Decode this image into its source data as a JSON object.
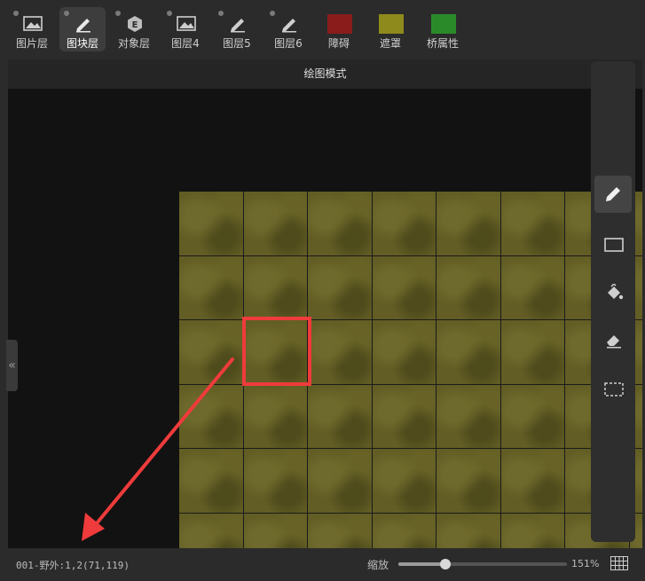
{
  "toolbar": {
    "items": [
      {
        "label": "图片层",
        "icon": "image-icon",
        "active": false
      },
      {
        "label": "图块层",
        "icon": "pencil-icon",
        "active": true
      },
      {
        "label": "对象层",
        "icon": "object-e-icon",
        "active": false
      },
      {
        "label": "图层4",
        "icon": "image-icon",
        "active": false
      },
      {
        "label": "图层5",
        "icon": "pencil-icon",
        "active": false
      },
      {
        "label": "图层6",
        "icon": "pencil-icon",
        "active": false
      }
    ],
    "swatches": [
      {
        "label": "障碍",
        "color": "#8b1c1c"
      },
      {
        "label": "遮罩",
        "color": "#8e8a1c"
      },
      {
        "label": "桥属性",
        "color": "#2a8a2a"
      }
    ]
  },
  "editor": {
    "mode_title": "绘图模式",
    "collapse_glyph": "«"
  },
  "right_tools": [
    {
      "name": "pencil-tool",
      "icon": "pencil-icon",
      "active": true
    },
    {
      "name": "rectangle-tool",
      "icon": "rectangle-icon",
      "active": false
    },
    {
      "name": "fill-tool",
      "icon": "paint-bucket-icon",
      "active": false
    },
    {
      "name": "eraser-tool",
      "icon": "eraser-icon",
      "active": false
    },
    {
      "name": "select-tool",
      "icon": "dashed-select-icon",
      "active": false
    }
  ],
  "status": {
    "text": "001-野外:1,2(71,119)",
    "zoom_label": "缩放",
    "zoom_value": "151%",
    "zoom_fraction": 0.28
  },
  "colors": {
    "accent_selection": "#ef3b3b",
    "tile": "#625d24"
  }
}
